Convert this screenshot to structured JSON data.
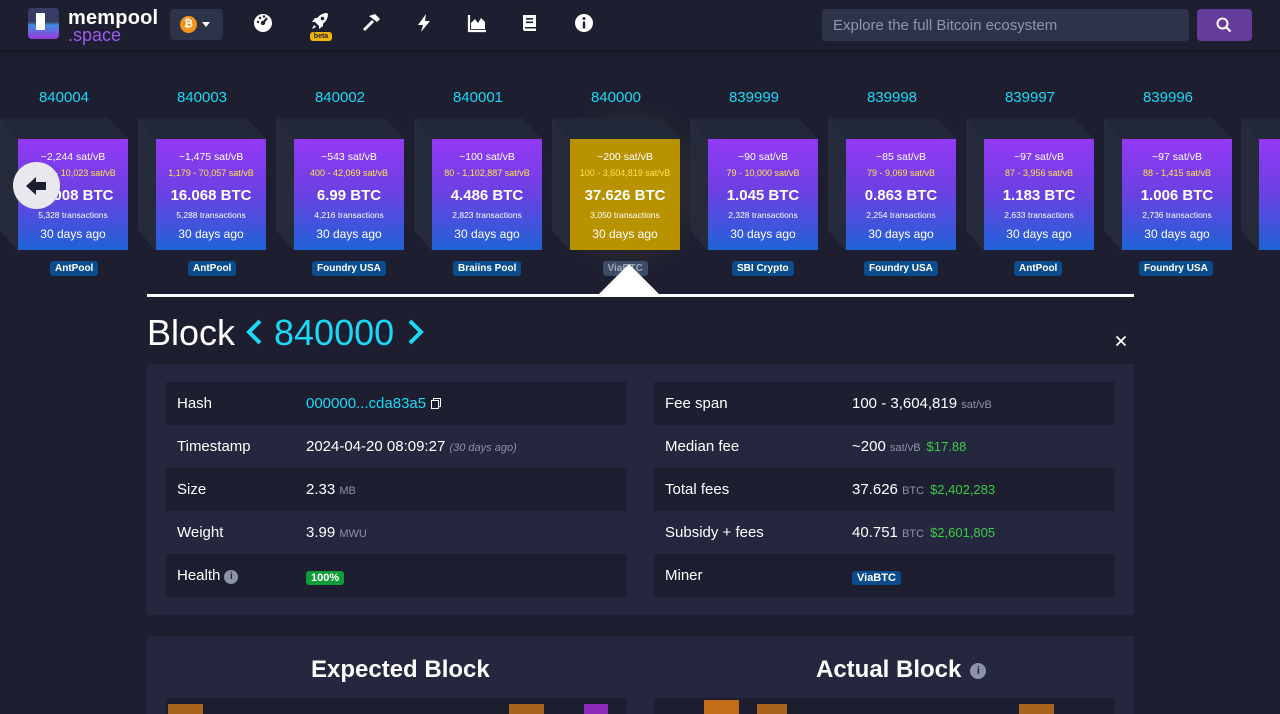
{
  "nav": {
    "logo_top": "mempool",
    "logo_bottom": ".space",
    "network_symbol": "₿",
    "beta_label": "beta",
    "search_placeholder": "Explore the full Bitcoin ecosystem",
    "icons": [
      "dashboard-icon",
      "rocket-icon",
      "hammer-icon",
      "lightning-icon",
      "chart-icon",
      "docs-icon",
      "info-icon"
    ],
    "accent_color": "#653b9c"
  },
  "blocks": [
    {
      "height": "840004",
      "median_fee": "~2,244 sat/vB",
      "fee_range": "2,345 - 10,023 sat/vB",
      "reward": "24.008 BTC",
      "tx_count": "5,328 transactions",
      "time_ago": "30 days ago",
      "pool": "AntPool"
    },
    {
      "height": "840003",
      "median_fee": "~1,475 sat/vB",
      "fee_range": "1,179 - 70,057 sat/vB",
      "reward": "16.068 BTC",
      "tx_count": "5,288 transactions",
      "time_ago": "30 days ago",
      "pool": "AntPool"
    },
    {
      "height": "840002",
      "median_fee": "~543 sat/vB",
      "fee_range": "400 - 42,069 sat/vB",
      "reward": "6.99 BTC",
      "tx_count": "4,216 transactions",
      "time_ago": "30 days ago",
      "pool": "Foundry USA"
    },
    {
      "height": "840001",
      "median_fee": "~100 sat/vB",
      "fee_range": "80 - 1,102,887 sat/vB",
      "reward": "4.486 BTC",
      "tx_count": "2,823 transactions",
      "time_ago": "30 days ago",
      "pool": "Braiins Pool"
    },
    {
      "height": "840000",
      "median_fee": "~200 sat/vB",
      "fee_range": "100 - 3,604,819 sat/vB",
      "reward": "37.626 BTC",
      "tx_count": "3,050 transactions",
      "time_ago": "30 days ago",
      "pool": "ViaBTC"
    },
    {
      "height": "839999",
      "median_fee": "~90 sat/vB",
      "fee_range": "79 - 10,000 sat/vB",
      "reward": "1.045 BTC",
      "tx_count": "2,328 transactions",
      "time_ago": "30 days ago",
      "pool": "SBI Crypto"
    },
    {
      "height": "839998",
      "median_fee": "~85 sat/vB",
      "fee_range": "79 - 9,069 sat/vB",
      "reward": "0.863 BTC",
      "tx_count": "2,254 transactions",
      "time_ago": "30 days ago",
      "pool": "Foundry USA"
    },
    {
      "height": "839997",
      "median_fee": "~97 sat/vB",
      "fee_range": "87 - 3,956 sat/vB",
      "reward": "1.183 BTC",
      "tx_count": "2,633 transactions",
      "time_ago": "30 days ago",
      "pool": "AntPool"
    },
    {
      "height": "839996",
      "median_fee": "~97 sat/vB",
      "fee_range": "88 - 1,415 sat/vB",
      "reward": "1.006 BTC",
      "tx_count": "2,736 transactions",
      "time_ago": "30 days ago",
      "pool": "Foundry USA"
    }
  ],
  "block": {
    "title": "Block",
    "height": "840000",
    "left": [
      {
        "label": "Hash",
        "value": "000000...cda83a5"
      },
      {
        "label": "Timestamp",
        "value": "2024-04-20 08:09:27",
        "note": "(30 days ago)"
      },
      {
        "label": "Size",
        "value": "2.33",
        "unit": "MB"
      },
      {
        "label": "Weight",
        "value": "3.99",
        "unit": "MWU"
      },
      {
        "label": "Health",
        "badge": "100%"
      }
    ],
    "right": [
      {
        "label": "Fee span",
        "value": "100 - 3,604,819",
        "unit": "sat/vB"
      },
      {
        "label": "Median fee",
        "value": "~200",
        "unit": "sat/vB",
        "usd": "$17.88"
      },
      {
        "label": "Total fees",
        "value": "37.626",
        "unit": "BTC",
        "usd": "$2,402,283"
      },
      {
        "label": "Subsidy + fees",
        "value": "40.751",
        "unit": "BTC",
        "usd": "$2,601,805"
      },
      {
        "label": "Miner",
        "badge": "ViaBTC"
      }
    ]
  },
  "audit": {
    "expected_title": "Expected Block",
    "actual_title": "Actual Block"
  }
}
